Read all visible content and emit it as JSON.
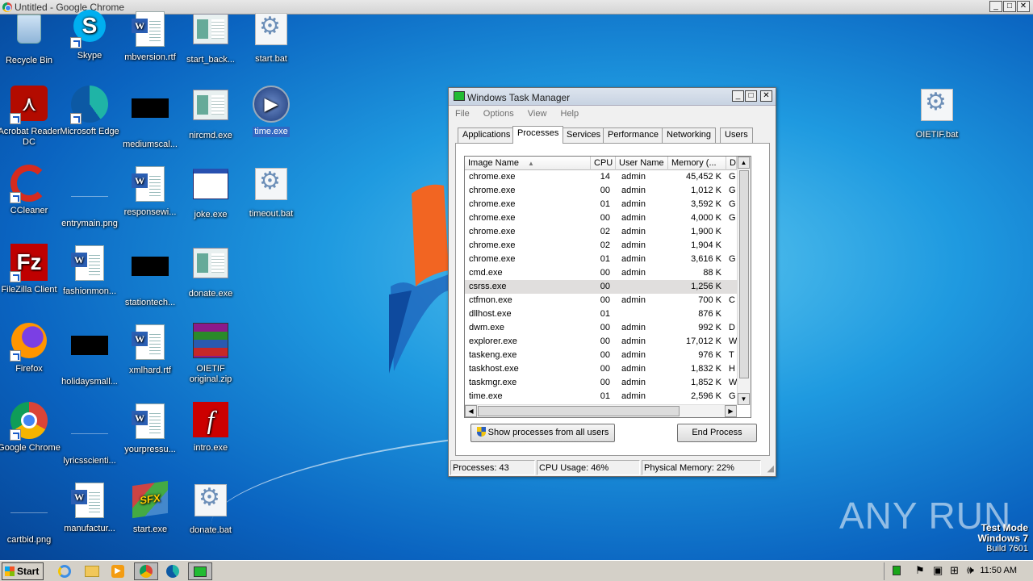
{
  "browser": {
    "title": "Untitled - Google Chrome"
  },
  "desktop_icons": [
    {
      "label": "Recycle Bin"
    },
    {
      "label": "Skype"
    },
    {
      "label": "mbversion.rtf"
    },
    {
      "label": "start_back..."
    },
    {
      "label": "start.bat"
    },
    {
      "label": "Acrobat Reader DC"
    },
    {
      "label": "Microsoft Edge"
    },
    {
      "label": "mediumscal..."
    },
    {
      "label": "nircmd.exe"
    },
    {
      "label": "time.exe"
    },
    {
      "label": "CCleaner"
    },
    {
      "label": "entrymain.png"
    },
    {
      "label": "responsewi..."
    },
    {
      "label": "joke.exe"
    },
    {
      "label": "timeout.bat"
    },
    {
      "label": "FileZilla Client"
    },
    {
      "label": "fashionmon..."
    },
    {
      "label": "stationtech..."
    },
    {
      "label": "donate.exe"
    },
    {
      "label": "Firefox"
    },
    {
      "label": "holidaysmall..."
    },
    {
      "label": "xmlhard.rtf"
    },
    {
      "label": "OIETIF original.zip"
    },
    {
      "label": "Google Chrome"
    },
    {
      "label": "lyricsscienti..."
    },
    {
      "label": "yourpressu..."
    },
    {
      "label": "intro.exe"
    },
    {
      "label": "cartbid.png"
    },
    {
      "label": "manufactur..."
    },
    {
      "label": "start.exe"
    },
    {
      "label": "donate.bat"
    },
    {
      "label": "OIETIF.bat"
    }
  ],
  "task_manager": {
    "title": "Windows Task Manager",
    "menu": [
      "File",
      "Options",
      "View",
      "Help"
    ],
    "tabs": [
      "Applications",
      "Processes",
      "Services",
      "Performance",
      "Networking",
      "Users"
    ],
    "active_tab": "Processes",
    "columns": [
      "Image Name",
      "CPU",
      "User Name",
      "Memory (...",
      "D"
    ],
    "processes": [
      {
        "name": "chrome.exe",
        "cpu": "14",
        "user": "admin",
        "mem": "45,452 K",
        "d": "G"
      },
      {
        "name": "chrome.exe",
        "cpu": "00",
        "user": "admin",
        "mem": "1,012 K",
        "d": "G"
      },
      {
        "name": "chrome.exe",
        "cpu": "01",
        "user": "admin",
        "mem": "3,592 K",
        "d": "G"
      },
      {
        "name": "chrome.exe",
        "cpu": "00",
        "user": "admin",
        "mem": "4,000 K",
        "d": "G"
      },
      {
        "name": "chrome.exe",
        "cpu": "02",
        "user": "admin",
        "mem": "1,900 K",
        "d": ""
      },
      {
        "name": "chrome.exe",
        "cpu": "02",
        "user": "admin",
        "mem": "1,904 K",
        "d": ""
      },
      {
        "name": "chrome.exe",
        "cpu": "01",
        "user": "admin",
        "mem": "3,616 K",
        "d": "G"
      },
      {
        "name": "cmd.exe",
        "cpu": "00",
        "user": "admin",
        "mem": "88 K",
        "d": ""
      },
      {
        "name": "csrss.exe",
        "cpu": "00",
        "user": "",
        "mem": "1,256 K",
        "d": ""
      },
      {
        "name": "ctfmon.exe",
        "cpu": "00",
        "user": "admin",
        "mem": "700 K",
        "d": "C"
      },
      {
        "name": "dllhost.exe",
        "cpu": "01",
        "user": "",
        "mem": "876 K",
        "d": ""
      },
      {
        "name": "dwm.exe",
        "cpu": "00",
        "user": "admin",
        "mem": "992 K",
        "d": "D"
      },
      {
        "name": "explorer.exe",
        "cpu": "00",
        "user": "admin",
        "mem": "17,012 K",
        "d": "W"
      },
      {
        "name": "taskeng.exe",
        "cpu": "00",
        "user": "admin",
        "mem": "976 K",
        "d": "T"
      },
      {
        "name": "taskhost.exe",
        "cpu": "00",
        "user": "admin",
        "mem": "1,832 K",
        "d": "H"
      },
      {
        "name": "taskmgr.exe",
        "cpu": "00",
        "user": "admin",
        "mem": "1,852 K",
        "d": "W"
      },
      {
        "name": "time.exe",
        "cpu": "01",
        "user": "admin",
        "mem": "2,596 K",
        "d": "G"
      }
    ],
    "show_all_button": "Show processes from all users",
    "end_process_button": "End Process",
    "status": {
      "processes": "Processes: 43",
      "cpu": "CPU Usage: 46%",
      "memory": "Physical Memory: 22%"
    }
  },
  "watermark": {
    "text": "ANY RUN"
  },
  "test_mode": {
    "line1": "Test Mode",
    "line2": "Windows 7",
    "line3": "Build 7601"
  },
  "taskbar": {
    "start_label": "Start",
    "clock": "11:50 AM"
  },
  "colors": {
    "accent": "#3167c1",
    "desktop": "#1f9ae0"
  }
}
